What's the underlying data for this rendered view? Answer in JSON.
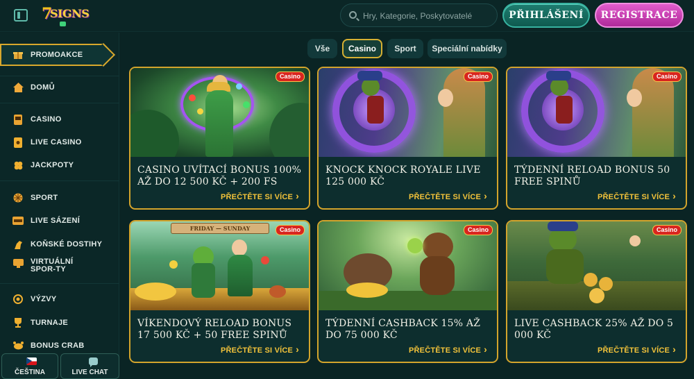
{
  "header": {
    "logo_text": "7SIGNS",
    "search_placeholder": "Hry, Kategorie, Poskytovatelé",
    "login_label": "PŘIHLÁŠENÍ",
    "register_label": "REGISTRACE"
  },
  "sidebar": {
    "promo_label": "PROMOAKCE",
    "items": [
      {
        "label": "DOMŮ",
        "icon": "home-icon"
      },
      {
        "label": "CASINO",
        "icon": "slot-machine-icon"
      },
      {
        "label": "LIVE CASINO",
        "icon": "card-icon"
      },
      {
        "label": "JACKPOTY",
        "icon": "clover-icon"
      },
      {
        "label": "SPORT",
        "icon": "ball-icon"
      },
      {
        "label": "LIVE SÁZENÍ",
        "icon": "live-icon"
      },
      {
        "label": "KOŇSKÉ DOSTIHY",
        "icon": "horse-icon"
      },
      {
        "label": "VIRTUÁLNÍ SPOR-TY",
        "icon": "virtual-sports-icon"
      },
      {
        "label": "VÝZVY",
        "icon": "medal-icon"
      },
      {
        "label": "TURNAJE",
        "icon": "trophy-icon"
      },
      {
        "label": "BONUS CRAB",
        "icon": "crab-icon"
      }
    ],
    "language_label": "ČEŠTINA",
    "chat_label": "LIVE CHAT"
  },
  "tabs": [
    {
      "label": "Vše",
      "active": false
    },
    {
      "label": "Casino",
      "active": true
    },
    {
      "label": "Sport",
      "active": false
    },
    {
      "label": "Speciální nabídky",
      "active": false
    }
  ],
  "cards": [
    {
      "badge": "Casino",
      "title": "CASINO UVÍTACÍ BONUS 100% AŽ DO 12 500 KČ + 200 FS",
      "link": "PŘEČTĚTE SI VÍCE"
    },
    {
      "badge": "Casino",
      "title": "KNOCK KNOCK ROYALE LIVE 125 000 KČ",
      "link": "PŘEČTĚTE SI VÍCE"
    },
    {
      "badge": "Casino",
      "title": "TÝDENNÍ RELOAD BONUS 50 FREE SPINŮ",
      "link": "PŘEČTĚTE SI VÍCE"
    },
    {
      "badge": "Casino",
      "title": "VÍKENDOVÝ RELOAD BONUS 17 500 KČ + 50 FREE SPINŮ",
      "link": "PŘEČTĚTE SI VÍCE",
      "banner": "FRIDAY — SUNDAY"
    },
    {
      "badge": "Casino",
      "title": "TÝDENNÍ CASHBACK 15% AŽ DO 75 000 KČ",
      "link": "PŘEČTĚTE SI VÍCE"
    },
    {
      "badge": "Casino",
      "title": "LIVE CASHBACK 25% AŽ DO 5 000 KČ",
      "link": "PŘEČTĚTE SI VÍCE"
    }
  ],
  "colors": {
    "accent_gold": "#d3a42c",
    "login_teal": "#1e7d70",
    "register_pink": "#d04bbd",
    "badge_red": "#d8251f"
  }
}
